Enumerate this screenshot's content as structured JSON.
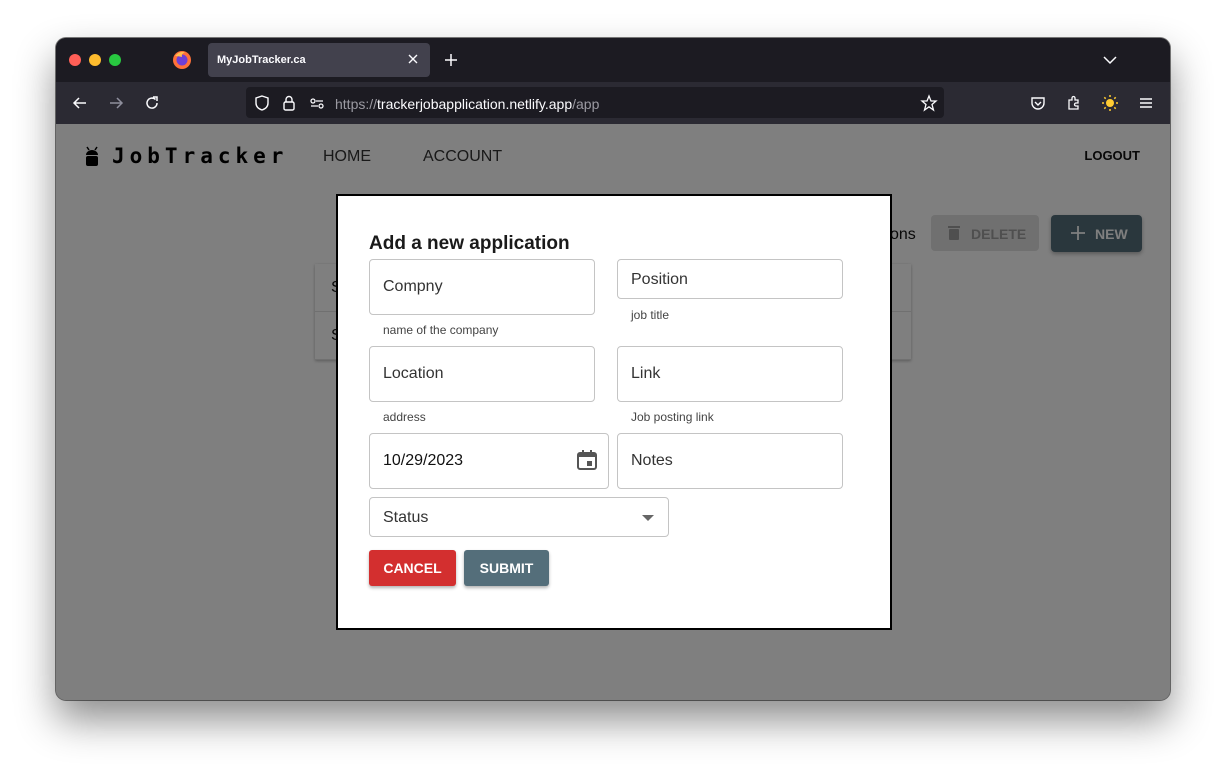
{
  "browser": {
    "tab_title": "MyJobTracker.ca",
    "url_scheme": "https://",
    "url_host": "trackerjobapplication.netlify.app",
    "url_path": "/app"
  },
  "app": {
    "logo_text": "JobTracker",
    "nav": [
      "HOME",
      "ACCOUNT"
    ],
    "logout_label": "LOGOUT",
    "partial_heading": "ons",
    "delete_label": "DELETE",
    "new_label": "NEW",
    "table_rows": [
      "S",
      "S"
    ]
  },
  "modal": {
    "title": "Add a new application",
    "company": {
      "placeholder": "Compny",
      "helper": "name of the company"
    },
    "position": {
      "placeholder": "Position",
      "helper": "job title"
    },
    "location": {
      "placeholder": "Location",
      "helper": "address"
    },
    "link": {
      "placeholder": "Link",
      "helper": "Job posting link"
    },
    "date": {
      "value": "10/29/2023"
    },
    "notes": {
      "placeholder": "Notes"
    },
    "status": {
      "placeholder": "Status"
    },
    "cancel_label": "CANCEL",
    "submit_label": "SUBMIT"
  },
  "colors": {
    "cancel": "#d32f2f",
    "submit": "#546e7a",
    "overlay": "rgba(0,0,0,0.5)"
  }
}
